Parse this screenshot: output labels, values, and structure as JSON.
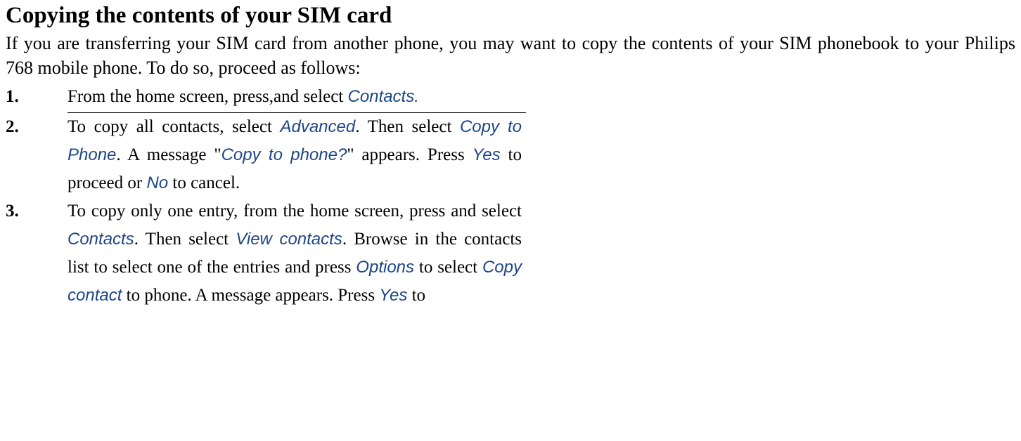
{
  "heading": "Copying the contents of your SIM card",
  "intro": "If you are transferring your SIM card from another phone, you may want to copy the contents of your SIM phonebook to your Philips 768 mobile phone. To do so, proceed as follows:",
  "steps": {
    "s1": {
      "num": "1.",
      "t1": "From the home screen, press,and select ",
      "m1": "Contacts."
    },
    "s2": {
      "num": "2.",
      "t1": "To copy all contacts, select ",
      "m1": "Advanced",
      "t2": ". Then select ",
      "m2": "Copy to Phone",
      "t3": ". A message \"",
      "m3": "Copy to phone?",
      "t4": "\" appears. Press ",
      "m4": "Yes",
      "t5": " to proceed or ",
      "m5": "No",
      "t6": " to cancel."
    },
    "s3": {
      "num": "3.",
      "t1": "To copy only one entry, from the home screen, press  and select ",
      "m1": "Contacts",
      "t2": ". Then select ",
      "m2": "View contacts",
      "t3": ". Browse in the contacts list to select one of the entries and press ",
      "m3": "Options",
      "t4": " to select ",
      "m4": "Copy contact",
      "t5": " to phone. A message appears. Press ",
      "m5": "Yes",
      "t6": " to"
    }
  }
}
